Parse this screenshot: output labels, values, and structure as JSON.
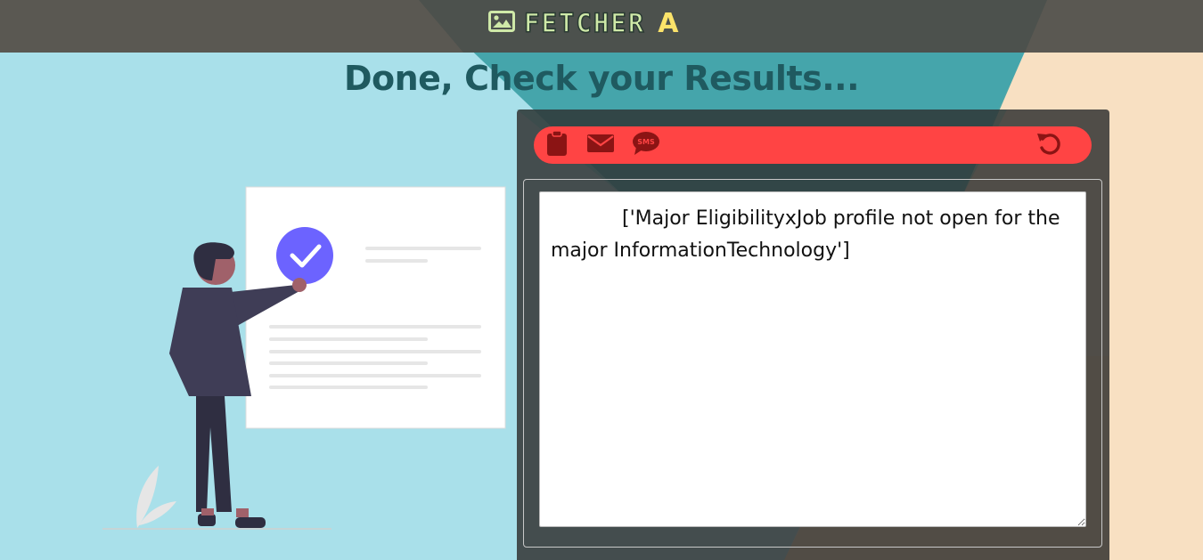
{
  "header": {
    "brand": "FETCHER",
    "brand_suffix": "A",
    "icon": "image-icon"
  },
  "headline": "Done, Check your Results...",
  "toolbar": {
    "icons": [
      "clipboard-icon",
      "envelope-icon",
      "sms-icon",
      "undo-icon"
    ],
    "sms_label": "SMS"
  },
  "result": {
    "text": "['Major EligibilityxJob profile not open for the major InformationTechnology']"
  },
  "colors": {
    "sky": "#a9e0ea",
    "topbar": "#5a5852",
    "peach": "#f8e0c2",
    "teal_triangle": "#3a9ea4",
    "toolbar_red": "#ff4444",
    "icon_dark_red": "#8b1414",
    "headline": "#1f5a60",
    "accent_purple": "#6c63ff"
  }
}
